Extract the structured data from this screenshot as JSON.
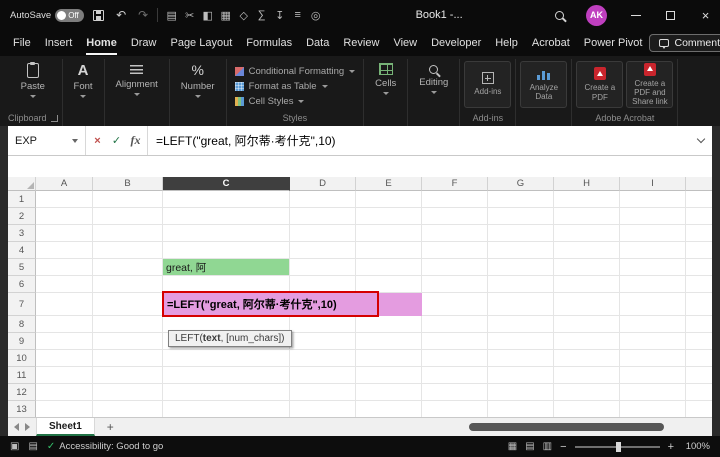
{
  "colors": {
    "share_button": "#1f9e54",
    "avatar_bg": "#bf3fbf",
    "sheet_tab_underline": "#217346"
  },
  "titlebar": {
    "autosave_label": "AutoSave",
    "autosave_state": "Off",
    "undo_glyph": "↶",
    "redo_glyph": "↷",
    "qat_icons": [
      {
        "name": "clipboard-icon",
        "glyph": "▤"
      },
      {
        "name": "cut-icon",
        "glyph": "✂"
      },
      {
        "name": "format-painter-icon",
        "glyph": "◧"
      },
      {
        "name": "picture-icon",
        "glyph": "▦"
      },
      {
        "name": "shapes-icon",
        "glyph": "◇"
      },
      {
        "name": "sum-icon",
        "glyph": "∑"
      },
      {
        "name": "sort-filter-icon",
        "glyph": "↧"
      },
      {
        "name": "list-icon",
        "glyph": "≡"
      },
      {
        "name": "target-icon",
        "glyph": "◎"
      }
    ],
    "title": "Book1 -...",
    "avatar_initials": "AK",
    "close_glyph": "×"
  },
  "menubar": {
    "items": [
      "File",
      "Insert",
      "Home",
      "Draw",
      "Page Layout",
      "Formulas",
      "Data",
      "Review",
      "View",
      "Developer",
      "Help",
      "Acrobat",
      "Power Pivot"
    ],
    "active_index": 2,
    "comments_label": "Comments"
  },
  "ribbon": {
    "paste_label": "Paste",
    "font_icon": "A",
    "font_label": "Font",
    "alignment_label": "Alignment",
    "number_icon": "%",
    "number_label": "Number",
    "styles_buttons": [
      "Conditional Formatting",
      "Format as Table",
      "Cell Styles"
    ],
    "cells_label": "Cells",
    "editing_label": "Editing",
    "addins_tile_label": "Add-ins",
    "analyze_tile_label": "Analyze Data",
    "pdf_create_label": "Create a PDF",
    "pdf_share_label": "Create a PDF and Share link",
    "group_labels": {
      "clipboard": "Clipboard",
      "styles": "Styles",
      "addins": "Add-ins",
      "adobe": "Adobe Acrobat"
    }
  },
  "formula_bar": {
    "name_box": "EXP",
    "cancel_glyph": "×",
    "enter_glyph": "✓",
    "fx_label": "fx",
    "formula": "=LEFT(\"great, 阿尔蒂·考什克\",10)"
  },
  "grid": {
    "columns": [
      "A",
      "B",
      "C",
      "D",
      "E",
      "F",
      "G",
      "H",
      "I"
    ],
    "selected_column": "C",
    "rows": [
      "1",
      "2",
      "3",
      "4",
      "5",
      "6",
      "7",
      "8",
      "9",
      "10",
      "11",
      "12",
      "13"
    ],
    "cells": {
      "C5": {
        "text": "great, 阿",
        "bg": "#90D793"
      }
    },
    "c7": {
      "row": "7",
      "formula": "=LEFT(\"great, 阿尔蒂·考什克\",10)",
      "fill": "#E49CE0",
      "fill_columns": [
        "C",
        "D",
        "E"
      ],
      "border_color": "#D50000"
    },
    "tooltip": {
      "prefix": "LEFT(",
      "bold": "text",
      "suffix": ", [num_chars])"
    }
  },
  "sheetbar": {
    "tabs": [
      "Sheet1"
    ],
    "active_tab": "Sheet1",
    "add_label": "+"
  },
  "statusbar": {
    "macro_glyph": "▣",
    "keyboard_glyph": "▤",
    "accessibility_check": "✓",
    "accessibility": "Accessibility: Good to go",
    "view_normal_glyph": "▦",
    "view_layout_glyph": "▤",
    "view_break_glyph": "▥",
    "zoom_out": "−",
    "zoom_in": "+",
    "zoom_level": "100%"
  }
}
